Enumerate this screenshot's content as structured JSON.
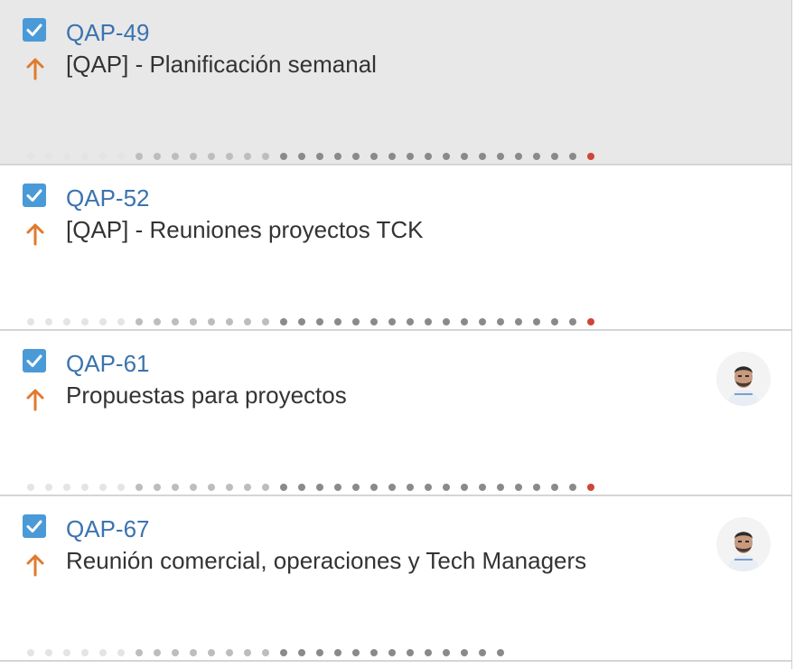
{
  "colors": {
    "issue_key": "#3b73af",
    "checkbox": "#4a9ad8",
    "priority_arrow": "#e07a2e",
    "dot_light": "#e4e4e4",
    "dot_mid": "#bdbdbd",
    "dot_dark": "#8a8a8a",
    "dot_red": "#d0443a",
    "selected_bg": "#e8e8e8"
  },
  "cards": [
    {
      "key": "QAP-49",
      "summary": "[QAP] - Planificación semanal",
      "type_icon": "checkbox-icon",
      "priority_icon": "priority-arrow-up-icon",
      "assignee_avatar": false,
      "selected": true,
      "red_end_dot": true
    },
    {
      "key": "QAP-52",
      "summary": "[QAP] - Reuniones proyectos TCK",
      "type_icon": "checkbox-icon",
      "priority_icon": "priority-arrow-up-icon",
      "assignee_avatar": false,
      "selected": false,
      "red_end_dot": true
    },
    {
      "key": "QAP-61",
      "summary": "Propuestas para proyectos",
      "type_icon": "checkbox-icon",
      "priority_icon": "priority-arrow-up-icon",
      "assignee_avatar": true,
      "selected": false,
      "red_end_dot": true
    },
    {
      "key": "QAP-67",
      "summary": "Reunión comercial, operaciones y Tech Managers",
      "type_icon": "checkbox-icon",
      "priority_icon": "priority-arrow-up-icon",
      "assignee_avatar": true,
      "selected": false,
      "red_end_dot": false
    }
  ]
}
